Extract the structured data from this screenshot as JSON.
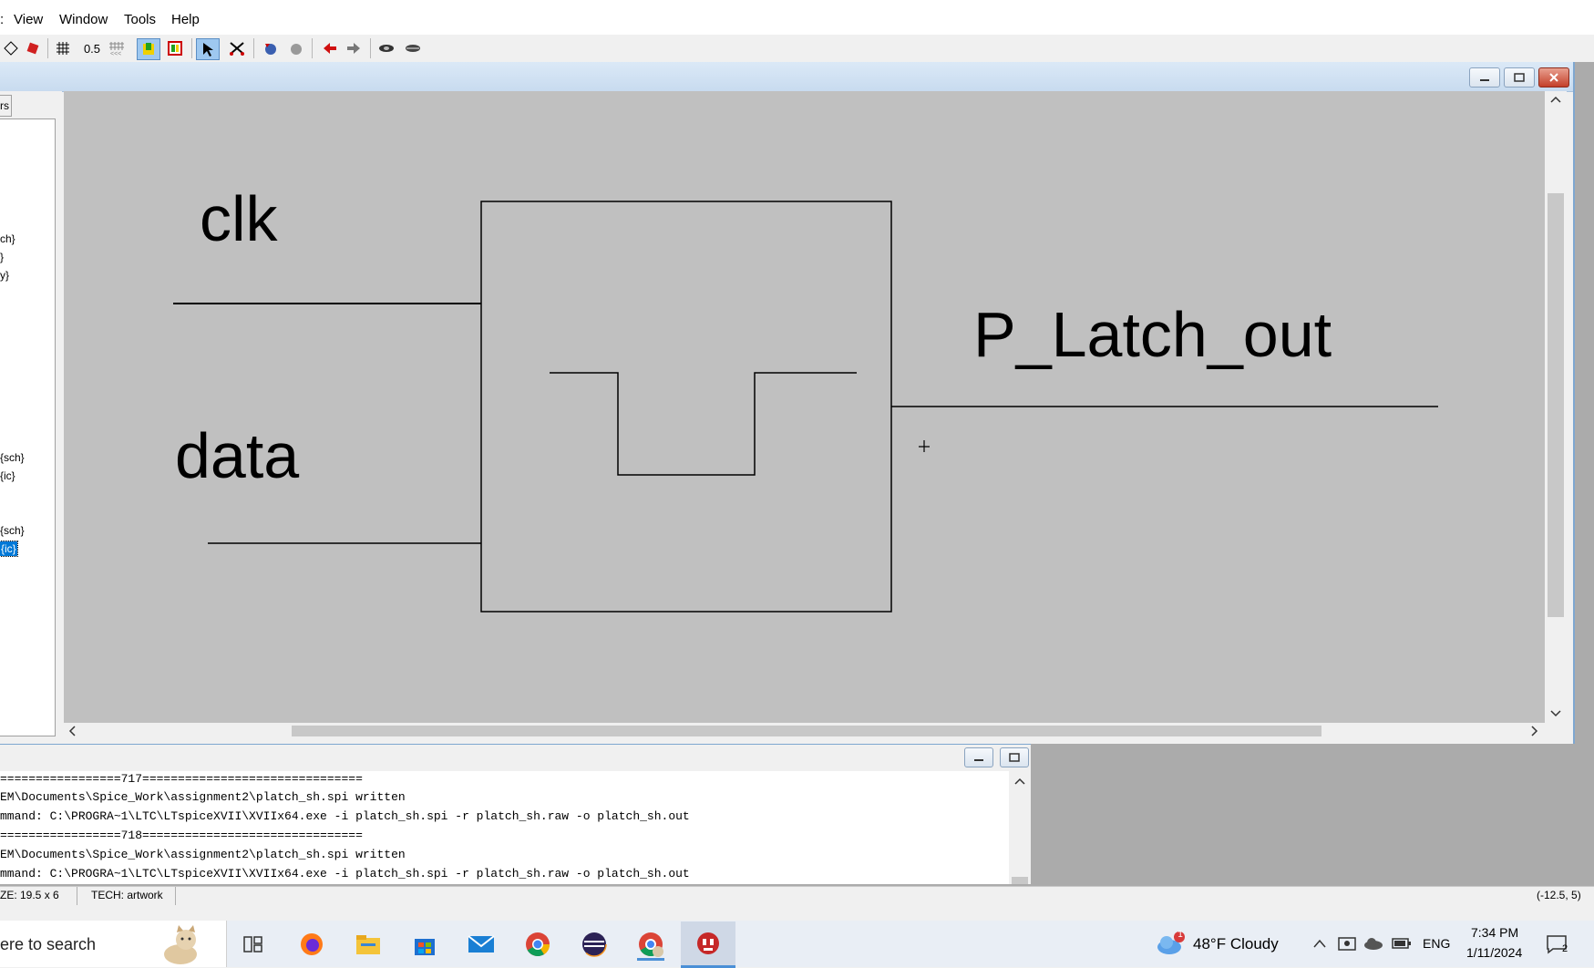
{
  "menu": {
    "items": [
      "View",
      "Window",
      "Tools",
      "Help"
    ]
  },
  "toolbar": {
    "grid_value": "0.5"
  },
  "explorer": {
    "tab_label": "rs",
    "tree_items": [
      "ch}",
      "}",
      "y}",
      "{sch}",
      "{ic}",
      "{sch}",
      "{ic}"
    ],
    "selected_index": 6
  },
  "schematic": {
    "clk_label": "clk",
    "data_label": "data",
    "output_label": "P_Latch_out"
  },
  "messages": {
    "lines": [
      "=================717===============================",
      "EM\\Documents\\Spice_Work\\assignment2\\platch_sh.spi written",
      "mmand: C:\\PROGRA~1\\LTC\\LTspiceXVII\\XVIIx64.exe -i platch_sh.spi -r platch_sh.raw -o platch_sh.out",
      "=================718===============================",
      "EM\\Documents\\Spice_Work\\assignment2\\platch_sh.spi written",
      "mmand: C:\\PROGRA~1\\LTC\\LTspiceXVII\\XVIIx64.exe -i platch_sh.spi -r platch_sh.raw -o platch_sh.out"
    ]
  },
  "status": {
    "size": "ZE: 19.5 x 6",
    "tech": "TECH: artwork",
    "coords": "(-12.5, 5)"
  },
  "taskbar": {
    "search_placeholder": "ere to search",
    "weather": "48°F  Cloudy",
    "weather_badge": "1",
    "language": "ENG",
    "time": "7:34 PM",
    "date": "1/11/2024",
    "notification_count": "2"
  },
  "colors": {
    "canvas_bg": "#c0c0c0",
    "selection": "#0078d7",
    "titlebar": "#c8dbef"
  }
}
